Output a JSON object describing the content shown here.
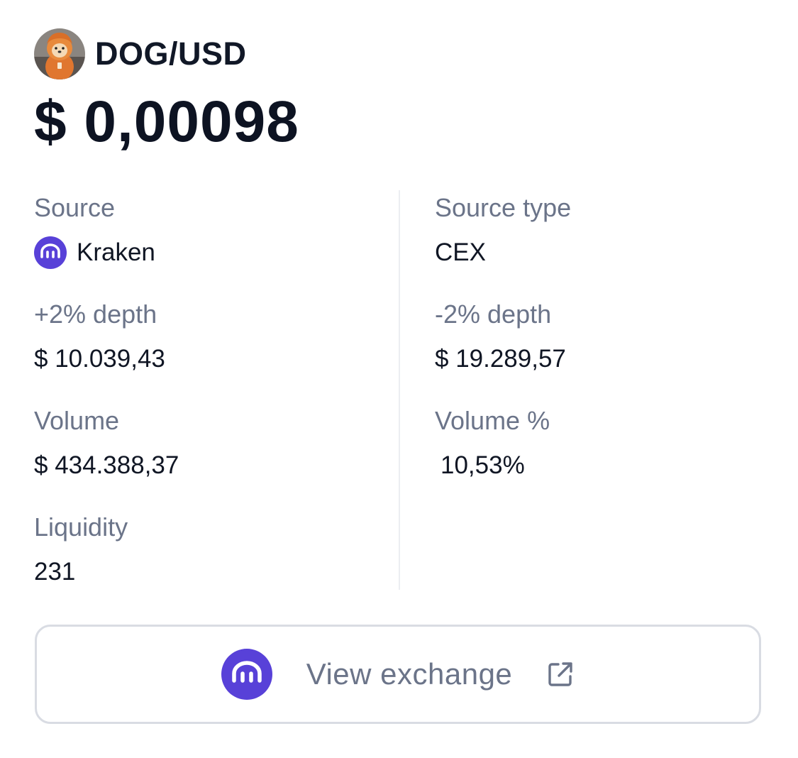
{
  "header": {
    "pair": "DOG/USD",
    "avatar_icon": "dog-token-avatar-icon"
  },
  "price": "$ 0,00098",
  "left": {
    "source_label": "Source",
    "source_value": "Kraken",
    "source_icon": "kraken-logo-icon",
    "plus_depth_label": "+2% depth",
    "plus_depth_value": "$ 10.039,43",
    "volume_label": "Volume",
    "volume_value": "$ 434.388,37",
    "liquidity_label": "Liquidity",
    "liquidity_value": "231"
  },
  "right": {
    "source_type_label": "Source type",
    "source_type_value": "CEX",
    "minus_depth_label": "-2% depth",
    "minus_depth_value": "$ 19.289,57",
    "volume_pct_label": "Volume %",
    "volume_pct_value": "10,53%"
  },
  "button": {
    "label": "View exchange",
    "logo_icon": "kraken-logo-icon",
    "link_icon": "external-link-icon"
  },
  "colors": {
    "kraken_purple": "#5841d8",
    "label_gray": "#6b7489",
    "text_dark": "#0f1523",
    "border": "#d9dce3"
  }
}
